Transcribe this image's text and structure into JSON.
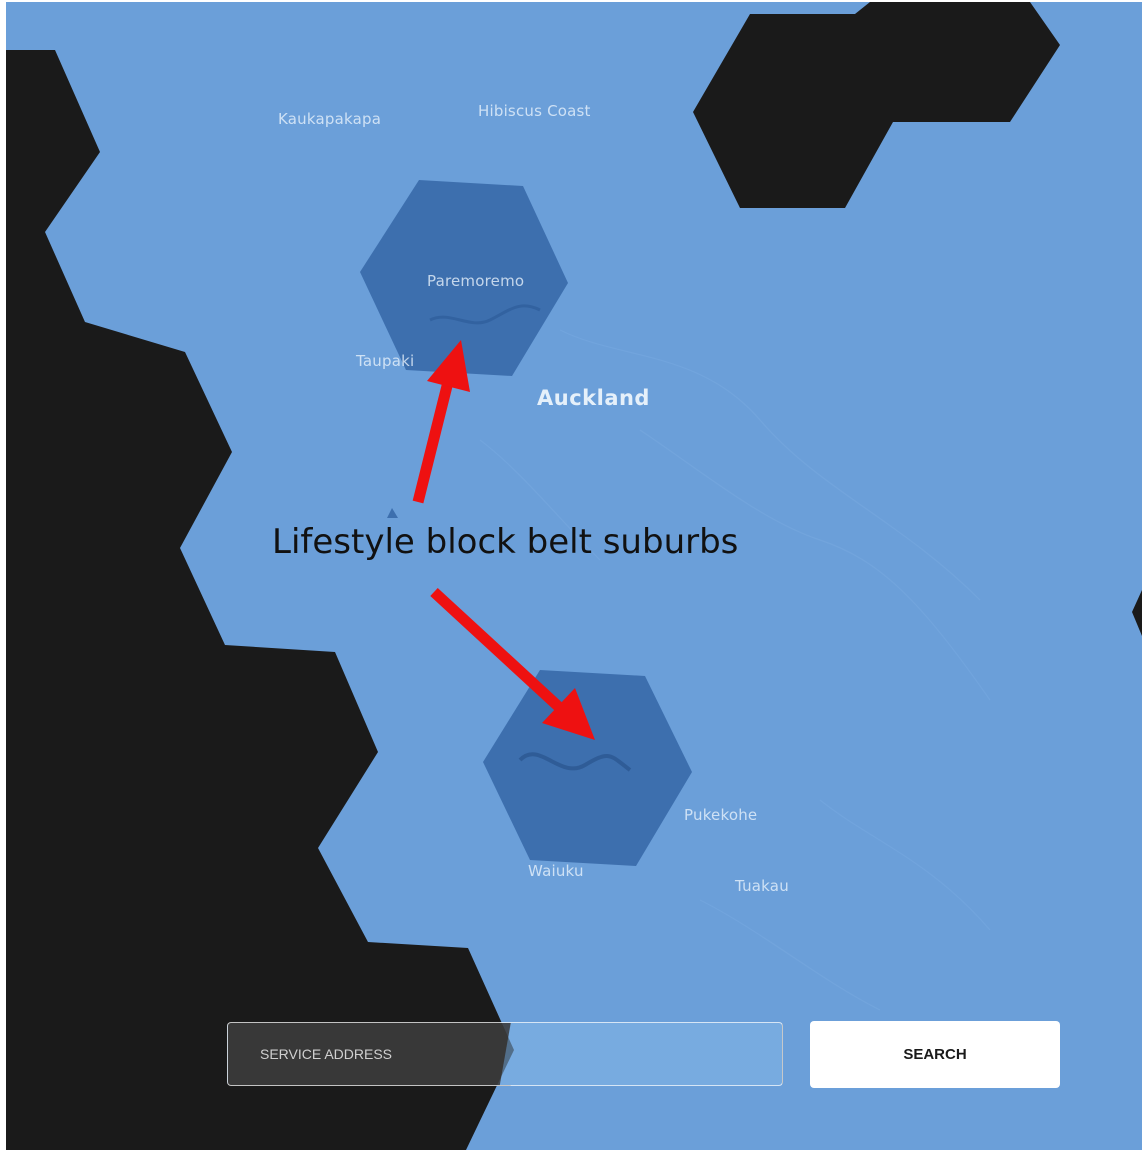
{
  "map": {
    "colors": {
      "coverage_fill": "#6b9fd9",
      "highlight_fill": "#3d6fae",
      "outside_fill": "#1a1a1a",
      "arrow": "#ee1111"
    },
    "places": {
      "kaukapakapa": "Kaukapakapa",
      "hibiscus_coast": "Hibiscus Coast",
      "paremoremo": "Paremoremo",
      "taupaki": "Taupaki",
      "auckland": "Auckland",
      "pukekohe": "Pukekohe",
      "waiuku": "Waiuku",
      "tuakau": "Tuakau"
    },
    "annotation": "Lifestyle block belt suburbs"
  },
  "search": {
    "placeholder": "SERVICE ADDRESS",
    "value": "",
    "button_label": "SEARCH"
  }
}
